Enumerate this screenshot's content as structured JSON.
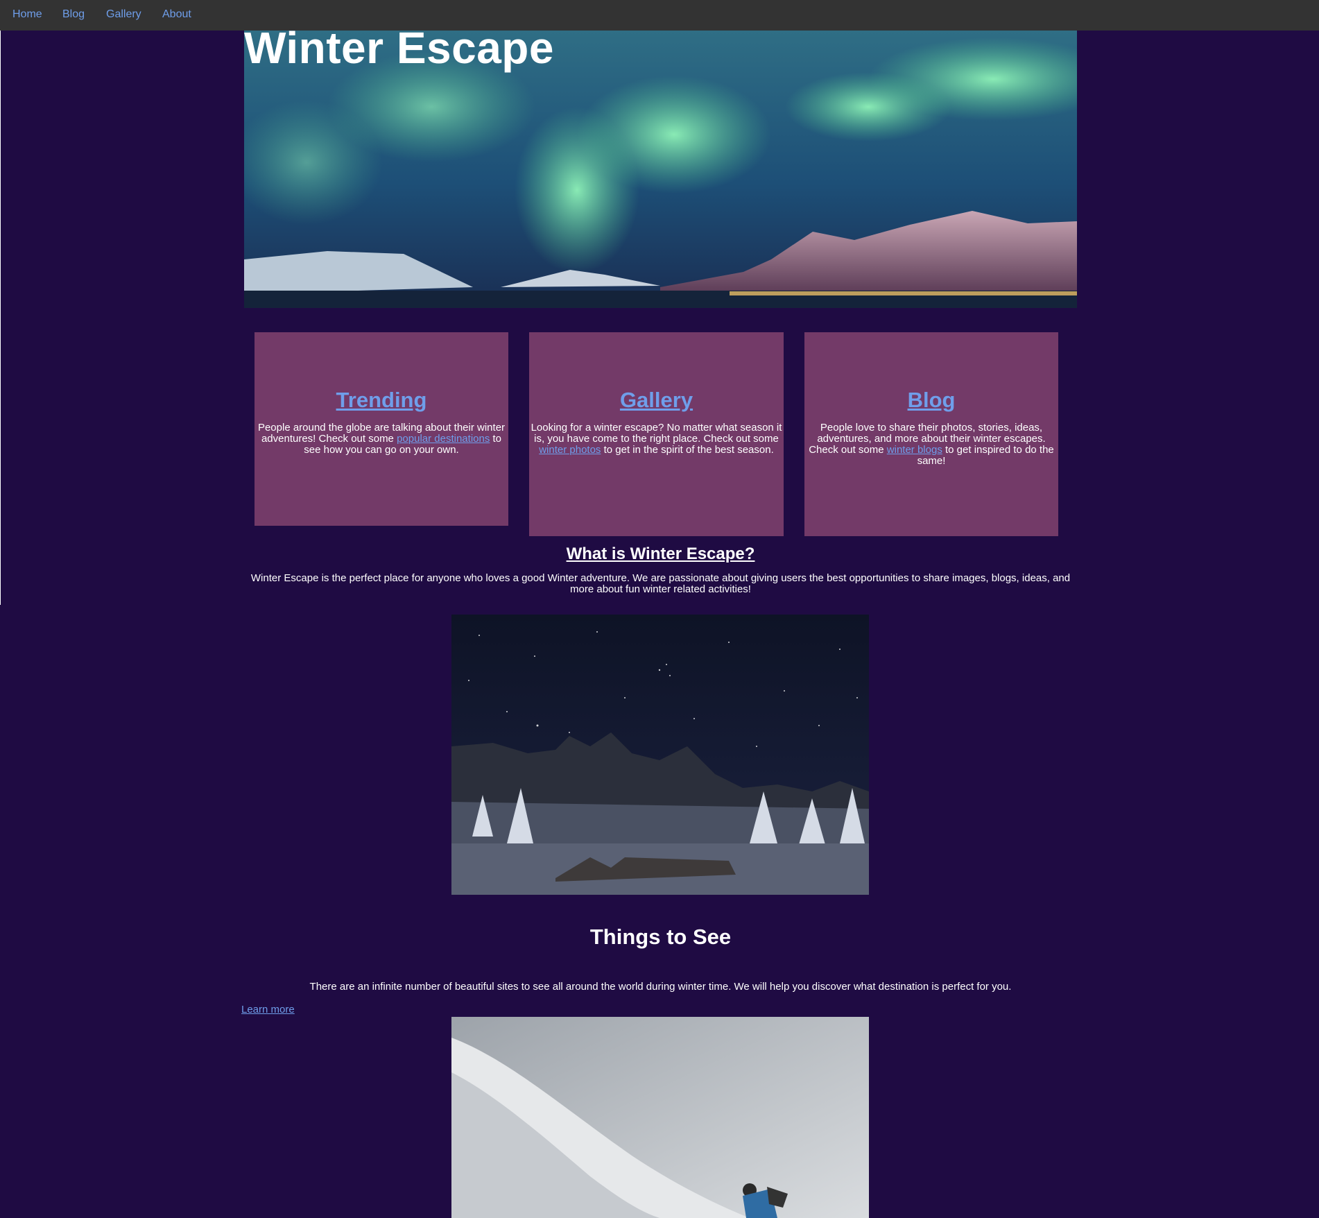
{
  "nav": {
    "items": [
      {
        "label": "Home"
      },
      {
        "label": "Blog"
      },
      {
        "label": "Gallery"
      },
      {
        "label": "About"
      }
    ]
  },
  "hero": {
    "title": "Winter Escape"
  },
  "cards": [
    {
      "title": "Trending",
      "text_before": "People around the globe are talking about their winter adventures! Check out some ",
      "link": "popular destinations",
      "text_after": " to see how you can go on your own."
    },
    {
      "title": "Gallery",
      "text_before": "Looking for a winter escape? No matter what season it is, you have come to the right place. Check out some ",
      "link": "winter photos",
      "text_after": " to get in the spirit of the best season."
    },
    {
      "title": "Blog",
      "text_before": "People love to share their photos, stories, ideas, adventures, and more about their winter escapes. Check out some ",
      "link": "winter blogs",
      "text_after": " to get inspired to do the same!"
    }
  ],
  "about": {
    "title": "What is Winter Escape?",
    "text": "Winter Escape is the perfect place for anyone who loves a good Winter adventure. We are passionate about giving users the best opportunities to share images, blogs, ideas, and more about fun winter related activities!"
  },
  "things": {
    "title": "Things to See",
    "text": "There are an infinite number of beautiful sites to see all around the world during winter time. We will help you discover what destination is perfect for you.",
    "link": "Learn more"
  },
  "colors": {
    "background": "#1f0b43",
    "nav": "#333333",
    "card": "#733a68",
    "link": "#6f9eea"
  }
}
